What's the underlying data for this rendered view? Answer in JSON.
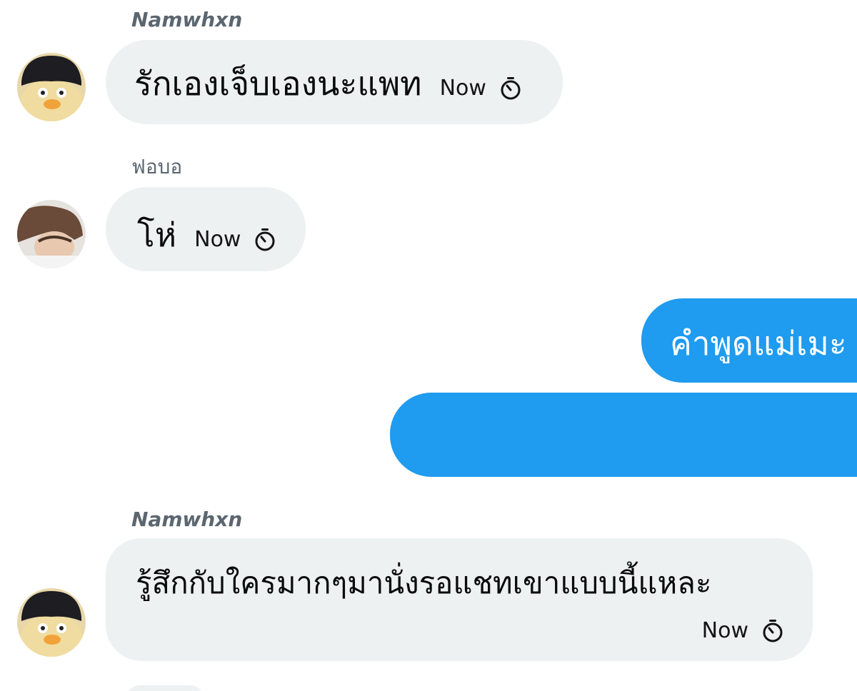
{
  "messages": [
    {
      "sender": "Namwhxn",
      "text": "รักเองเจ็บเองนะแพท",
      "time": "Now",
      "direction": "in",
      "avatar": "duck-avatar"
    },
    {
      "sender": "ฟอบอ",
      "text": "โห่",
      "time": "Now",
      "direction": "in",
      "avatar": "person-avatar"
    },
    {
      "text": "คำพูดแม่เมะ",
      "direction": "out"
    },
    {
      "text": "",
      "direction": "out"
    },
    {
      "sender": "Namwhxn",
      "text": "รู้สึกกับใครมากๆมานั่งรอแชทเขาแบบนี้แหละ",
      "time": "Now",
      "direction": "in",
      "avatar": "duck-avatar"
    }
  ],
  "colors": {
    "incoming_bubble": "#edf1f2",
    "outgoing_bubble": "#1f9bef",
    "sender_name": "#5b6670"
  },
  "icons": {
    "timer": "stopwatch-icon"
  }
}
